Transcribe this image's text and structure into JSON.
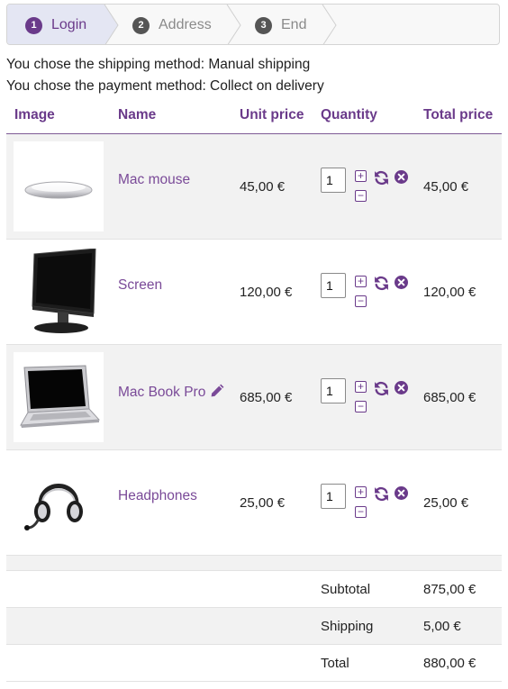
{
  "steps": [
    {
      "number": "1",
      "label": "Login",
      "active": true
    },
    {
      "number": "2",
      "label": "Address",
      "active": false
    },
    {
      "number": "3",
      "label": "End",
      "active": false
    }
  ],
  "info": {
    "shipping": "You chose the shipping method: Manual shipping",
    "payment": "You chose the payment method: Collect on delivery"
  },
  "table": {
    "headers": {
      "image": "Image",
      "name": "Name",
      "unit_price": "Unit price",
      "quantity": "Quantity",
      "total_price": "Total price"
    },
    "rows": [
      {
        "name": "Mac mouse",
        "unit_price": "45,00 €",
        "quantity": "1",
        "total": "45,00 €",
        "image_icon": "mouse-image",
        "editable": false
      },
      {
        "name": "Screen",
        "unit_price": "120,00 €",
        "quantity": "1",
        "total": "120,00 €",
        "image_icon": "monitor-image",
        "editable": false
      },
      {
        "name": "Mac Book Pro",
        "unit_price": "685,00 €",
        "quantity": "1",
        "total": "685,00 €",
        "image_icon": "laptop-image",
        "editable": true
      },
      {
        "name": "Headphones",
        "unit_price": "25,00 €",
        "quantity": "1",
        "total": "25,00 €",
        "image_icon": "headphones-image",
        "editable": false
      }
    ],
    "row_icons": [
      "plus-icon",
      "minus-icon",
      "refresh-icon",
      "remove-icon",
      "pencil-icon"
    ]
  },
  "summary": {
    "subtotal_label": "Subtotal",
    "subtotal": "875,00 €",
    "shipping_label": "Shipping",
    "shipping": "5,00 €",
    "total_label": "Total",
    "total": "880,00 €"
  },
  "colors": {
    "accent": "#6a3a8a",
    "link": "#7a4a98",
    "active_step_bg": "#e4e6f3",
    "row_shade": "#f2f2f2"
  }
}
